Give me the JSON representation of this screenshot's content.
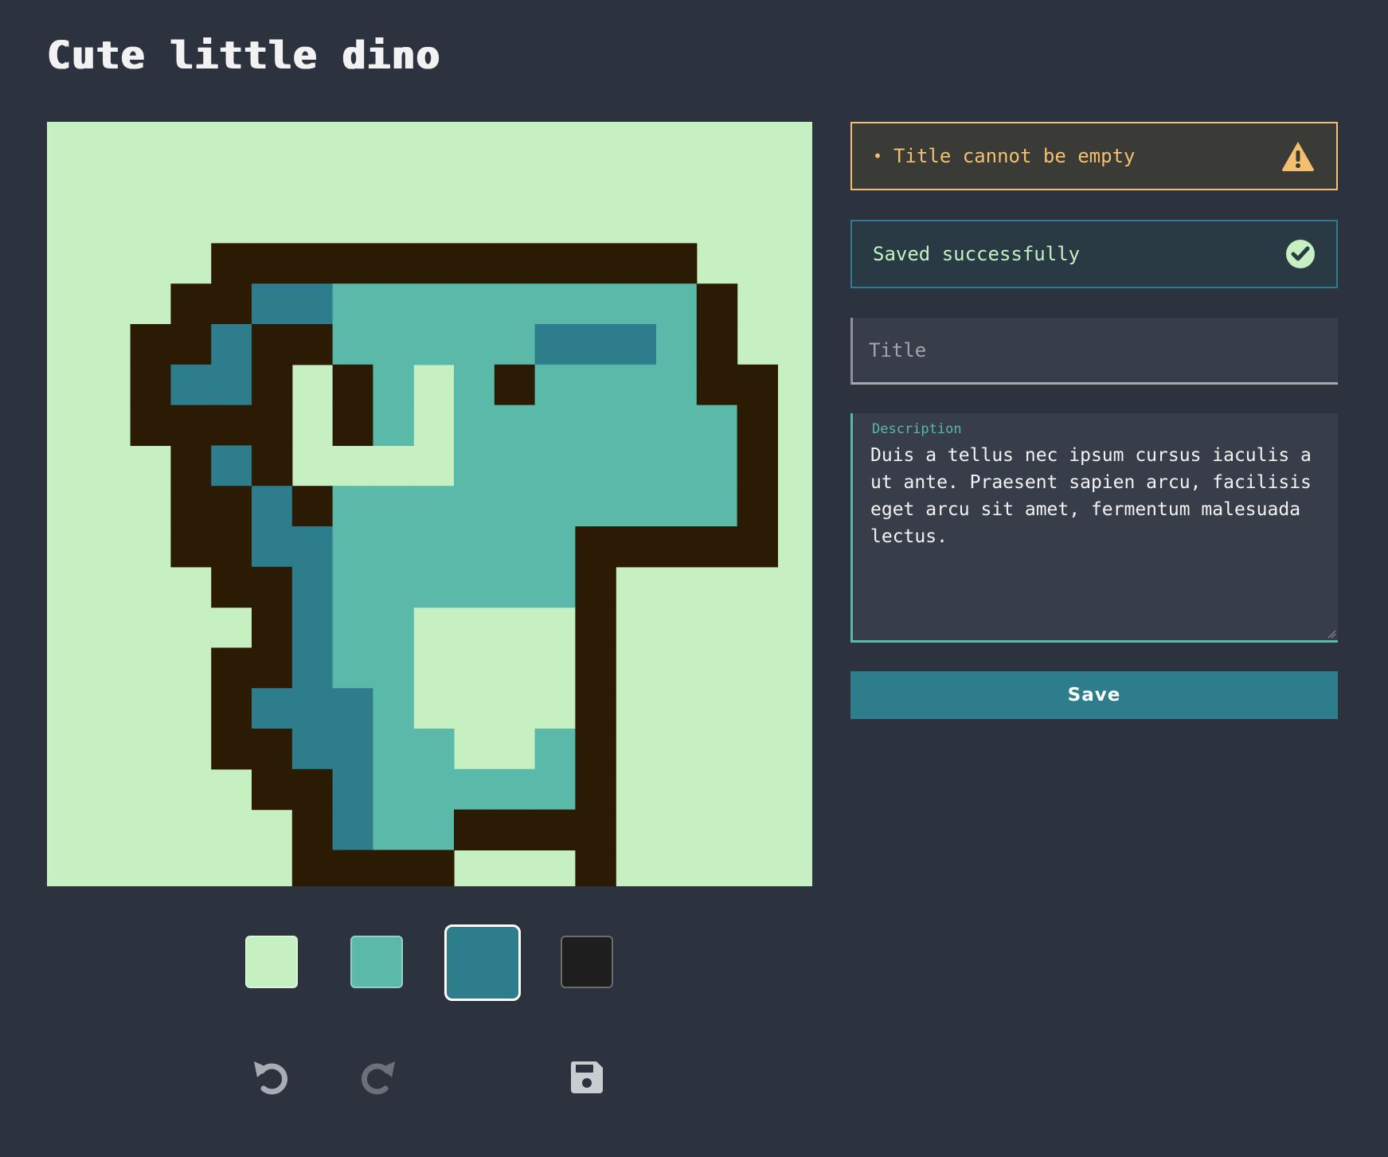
{
  "header": {
    "title": "Cute little dino"
  },
  "pixel_art": {
    "colors": {
      "0": "#c6f0c2",
      "1": "#5ab9a8",
      "2": "#2e7d8c",
      "3": "#2b1b04"
    },
    "grid": [
      "0000000000000000000",
      "0000000000000000000",
      "0000000000000000000",
      "0000333333333333000",
      "0003322111111111300",
      "0033233111112221300",
      "0032230310131111330",
      "0033330310111111130",
      "0003230000111111130",
      "0003323111111111130",
      "0003322111111333330",
      "0000332111111300000",
      "0000032110000300000",
      "0000332110000300000",
      "0000322210000300000",
      "0000332211001300000",
      "0000033211111300000",
      "0000003211333300000",
      "0000003333000300000",
      "0000000000000000000"
    ]
  },
  "palette": {
    "swatches": [
      {
        "name": "light-green",
        "color": "#c6f0c2",
        "selected": false
      },
      {
        "name": "teal",
        "color": "#5ab9a8",
        "selected": false
      },
      {
        "name": "dark-teal",
        "color": "#2e7d8c",
        "selected": true
      },
      {
        "name": "black",
        "color": "#1e1e1e",
        "selected": false
      }
    ]
  },
  "toolbar": {
    "undo_icon": "undo-icon",
    "redo_icon": "redo-icon",
    "save_icon": "floppy-disk-icon"
  },
  "alerts": {
    "error": {
      "text": "Title cannot be empty",
      "icon": "warning-triangle-icon",
      "color": "#f4bf6e"
    },
    "success": {
      "text": "Saved successfully",
      "icon": "check-circle-icon",
      "color": "#c6f0c2"
    }
  },
  "form": {
    "title_placeholder": "Title",
    "title_value": "",
    "description_label": "Description",
    "description_value": "Duis a tellus nec ipsum cursus iaculis a ut ante. Praesent sapien arcu, facilisis eget arcu sit amet, fermentum malesuada lectus.",
    "save_label": "Save"
  }
}
